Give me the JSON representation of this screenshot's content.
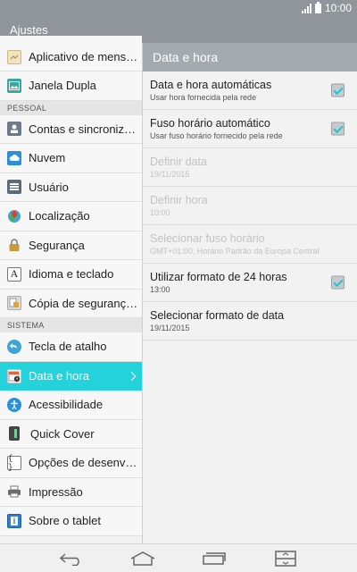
{
  "status_bar": {
    "time": "10:00",
    "icons": [
      "signal-icon",
      "battery-icon"
    ]
  },
  "app_bar": {
    "title": "Ajustes"
  },
  "sidebar": {
    "items": [
      {
        "label": "Aplicativo de mensagens",
        "icon": "messaging-app-icon",
        "color": "#e8d9a8"
      },
      {
        "label": "Janela Dupla",
        "icon": "dual-window-icon",
        "color": "#3aa6a0"
      },
      {
        "section": "PESSOAL"
      },
      {
        "label": "Contas e sincronização",
        "icon": "accounts-sync-icon",
        "color": "#6b7b8c"
      },
      {
        "label": "Nuvem",
        "icon": "cloud-icon",
        "color": "#2f8fd8"
      },
      {
        "label": "Usuário",
        "icon": "user-icon",
        "color": "#5a6b7d"
      },
      {
        "label": "Localização",
        "icon": "location-icon",
        "color": "#48b04a"
      },
      {
        "label": "Segurança",
        "icon": "lock-icon",
        "color": "#c69a3a"
      },
      {
        "label": "Idioma e teclado",
        "icon": "language-keyboard-icon",
        "color": "#ffffff"
      },
      {
        "label": "Cópia de segurança e restauração",
        "icon": "backup-icon",
        "color": "#e0a33a"
      },
      {
        "section": "SISTEMA"
      },
      {
        "label": "Tecla de atalho",
        "icon": "shortcut-key-icon",
        "color": "#3fa4d6"
      },
      {
        "label": "Data e hora",
        "icon": "calendar-clock-icon",
        "color": "#e8623a",
        "active": true
      },
      {
        "label": "Acessibilidade",
        "icon": "accessibility-icon",
        "color": "#2b8fe0"
      },
      {
        "label": "Quick Cover",
        "icon": "quick-cover-icon",
        "color": "#444444"
      },
      {
        "label": "Opções de desenvolvedor",
        "icon": "developer-options-icon",
        "color": "#555555"
      },
      {
        "label": "Impressão",
        "icon": "printer-icon",
        "color": "#6b6b6b"
      },
      {
        "label": "Sobre o tablet",
        "icon": "about-tablet-icon",
        "color": "#2d7fd0"
      }
    ]
  },
  "detail": {
    "title": "Data e hora",
    "items": [
      {
        "title": "Data e hora automáticas",
        "subtitle": "Usar hora fornecida pela rede",
        "checked": true,
        "enabled": true
      },
      {
        "title": "Fuso horário automático",
        "subtitle": "Usar fuso horário fornecido pela rede",
        "checked": true,
        "enabled": true
      },
      {
        "title": "Definir data",
        "subtitle": "19/11/2015",
        "enabled": false
      },
      {
        "title": "Definir hora",
        "subtitle": "10:00",
        "enabled": false
      },
      {
        "title": "Selecionar fuso horário",
        "subtitle": "GMT+01:00, Horário Padrão da Europa Central",
        "enabled": false
      },
      {
        "title": "Utilizar formato de 24 horas",
        "subtitle": "13:00",
        "checked": true,
        "enabled": true
      },
      {
        "title": "Selecionar formato de data",
        "subtitle": "19/11/2015",
        "enabled": true
      }
    ]
  },
  "nav_bar": {
    "buttons": [
      "back-icon",
      "home-icon",
      "recent-apps-icon",
      "dual-window-nav-icon"
    ]
  },
  "colors": {
    "accent": "#24d2dc",
    "header": "#8f959a",
    "detail_header": "#a4abb0"
  }
}
